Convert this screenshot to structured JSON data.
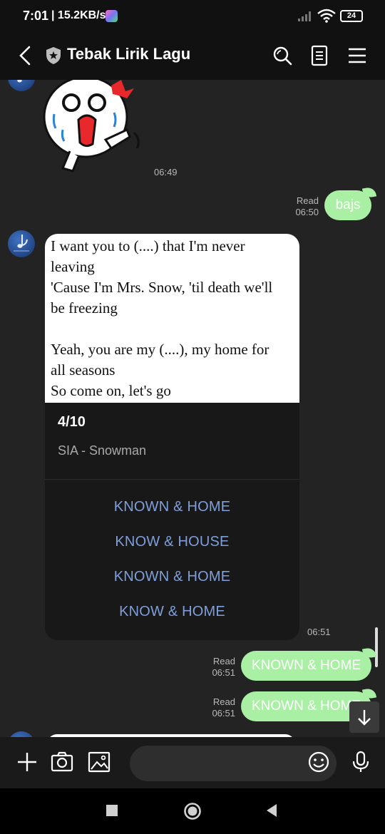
{
  "status": {
    "time": "7:01",
    "speed": "| 15.2KB/s",
    "battery": "24"
  },
  "header": {
    "title": "Tebak Lirik Lagu"
  },
  "messages": {
    "sticker_time": "06:49",
    "bajs": {
      "text": "bajs",
      "read": "Read",
      "time": "06:50"
    },
    "quiz": {
      "lyrics": [
        "I want you to (....) that I'm never",
        "leaving",
        "'Cause I'm Mrs. Snow, 'til death we'll",
        "be freezing",
        "",
        "Yeah, you are my (....), my home for",
        "all seasons",
        "So come on, let's go"
      ],
      "score": "4/10",
      "song": "SIA - Snowman",
      "options": [
        "KNOWN & HOME",
        "KNOW & HOUSE",
        "KNOWN & HOME",
        "KNOW & HOME"
      ],
      "time": "06:51"
    },
    "reply1": {
      "text": "KNOWN & HOME",
      "read": "Read",
      "time": "06:51"
    },
    "reply2": {
      "text": "KNOWN & HOME",
      "read": "Read",
      "time": "06:51"
    }
  },
  "input": {
    "placeholder": ""
  },
  "colors": {
    "outgoing_bubble": "#a9f0a4",
    "option_link": "#7f9fdc",
    "background": "#232323"
  },
  "icons": [
    "back-icon",
    "shield-icon",
    "search-icon",
    "notes-icon",
    "menu-icon",
    "plus-icon",
    "camera-icon",
    "image-icon",
    "emoji-icon",
    "mic-icon",
    "arrow-down-icon",
    "square-nav-icon",
    "circle-nav-icon",
    "triangle-nav-icon"
  ]
}
